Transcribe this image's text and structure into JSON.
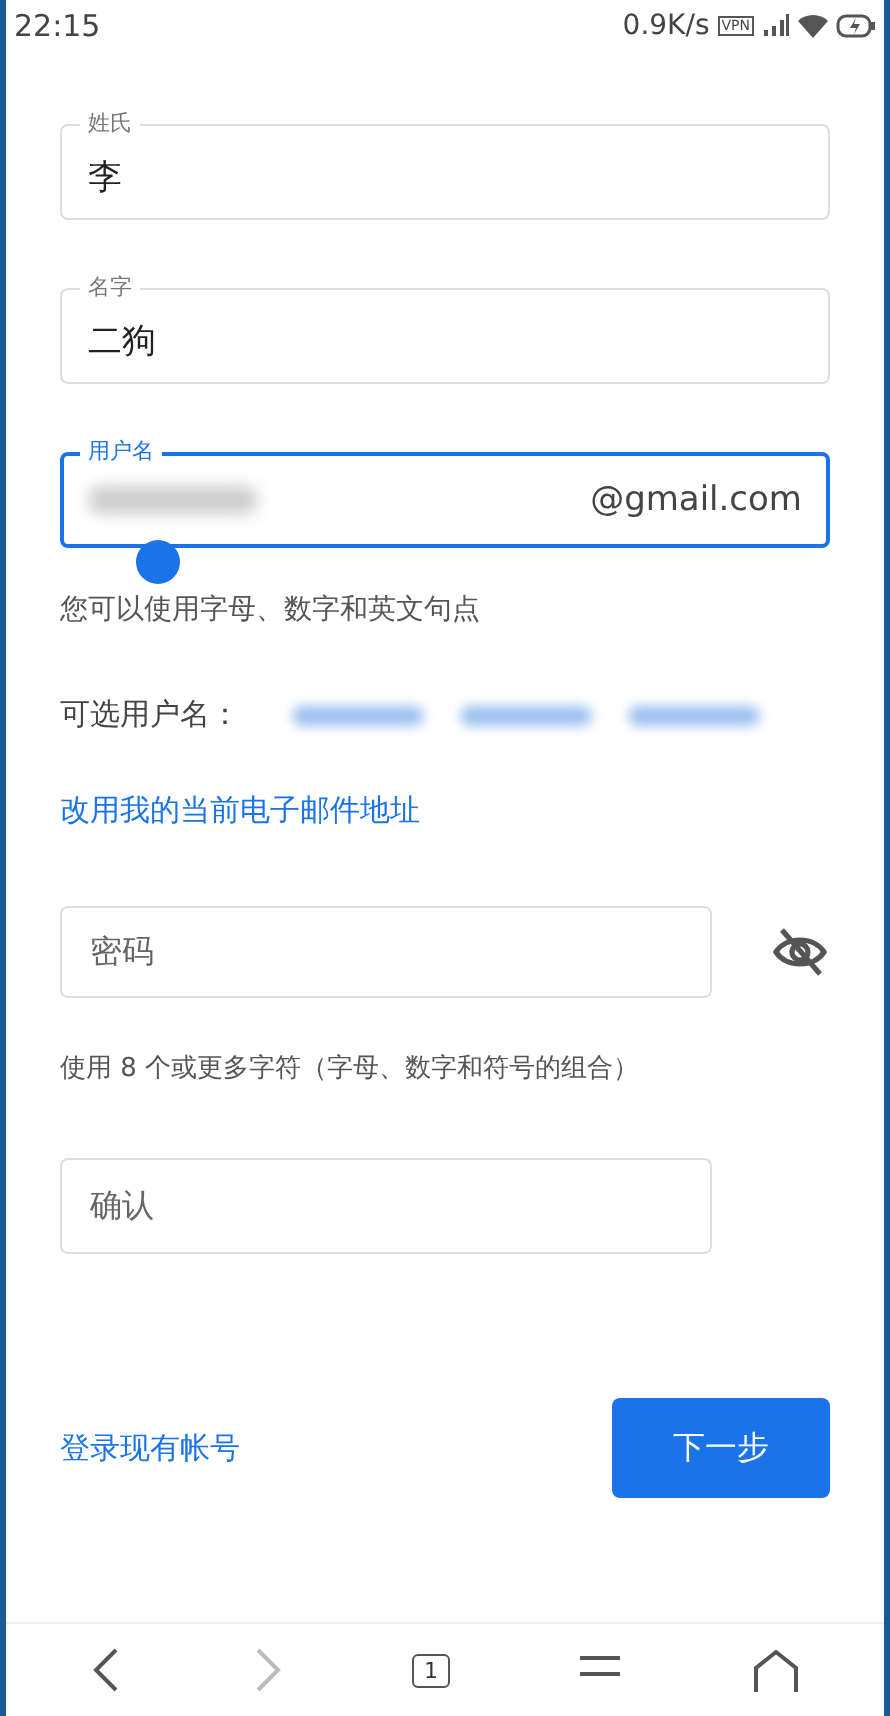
{
  "status_bar": {
    "time": "22:15",
    "speed": "0.9K/s",
    "vpn": "VPN"
  },
  "name_fields": [
    {
      "label": "姓氏",
      "value": "李",
      "focused": false
    },
    {
      "label": "名字",
      "value": "二狗",
      "focused": false
    }
  ],
  "username": {
    "label": "用户名",
    "suffix": "@gmail.com",
    "focused": true,
    "hint": "您可以使用字母、数字和英文句点"
  },
  "suggestions_label": "可选用户名：",
  "use_current_email_link": "改用我的当前电子邮件地址",
  "password": {
    "placeholder": "密码",
    "hint": "使用 8 个或更多字符（字母、数字和符号的组合）"
  },
  "confirm": {
    "placeholder": "确认"
  },
  "sign_in_link": "登录现有帐号",
  "next_button": "下一步",
  "nav_bar": {
    "tab_count": "1"
  }
}
